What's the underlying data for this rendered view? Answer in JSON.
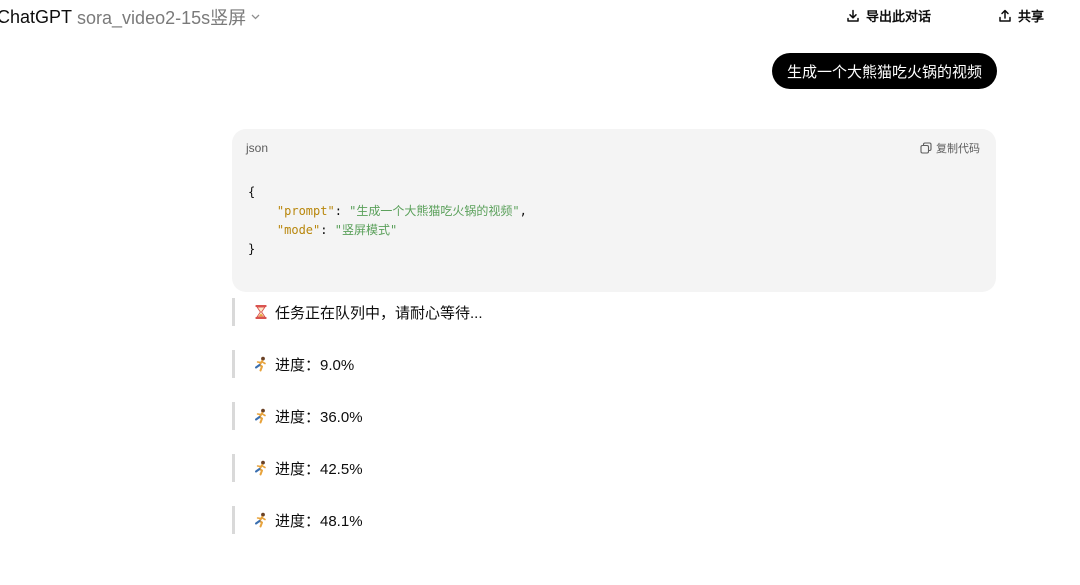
{
  "header": {
    "app_title": "ChatGPT",
    "model_name": "sora_video2-15s竖屏",
    "chevron_icon": "chevron-down-icon",
    "export_label": "导出此对话",
    "export_icon": "download-icon",
    "share_label": "共享",
    "share_icon": "share-icon"
  },
  "conversation": {
    "user_message": "生成一个大熊猫吃火锅的视频",
    "code_block": {
      "language": "json",
      "copy_label": "复制代码",
      "copy_icon": "copy-icon",
      "open_brace": "{",
      "close_brace": "}",
      "lines": [
        {
          "key": "\"prompt\"",
          "value": "\"生成一个大熊猫吃火锅的视频\"",
          "trailing": ","
        },
        {
          "key": "\"mode\"",
          "value": "\"竖屏模式\"",
          "trailing": ""
        }
      ]
    },
    "status_messages": [
      {
        "icon": "hourglass-icon",
        "text": "任务正在队列中，请耐心等待..."
      },
      {
        "icon": "running-person-icon",
        "text": "进度：9.0%"
      },
      {
        "icon": "running-person-icon",
        "text": "进度：36.0%"
      },
      {
        "icon": "running-person-icon",
        "text": "进度：42.5%"
      },
      {
        "icon": "running-person-icon",
        "text": "进度：48.1%"
      }
    ]
  },
  "colors": {
    "bubble_bg": "#000000",
    "code_bg": "#f4f4f4",
    "json_key": "#b8860b",
    "json_string": "#5aa05a",
    "quote_border": "#d9d9d9"
  }
}
